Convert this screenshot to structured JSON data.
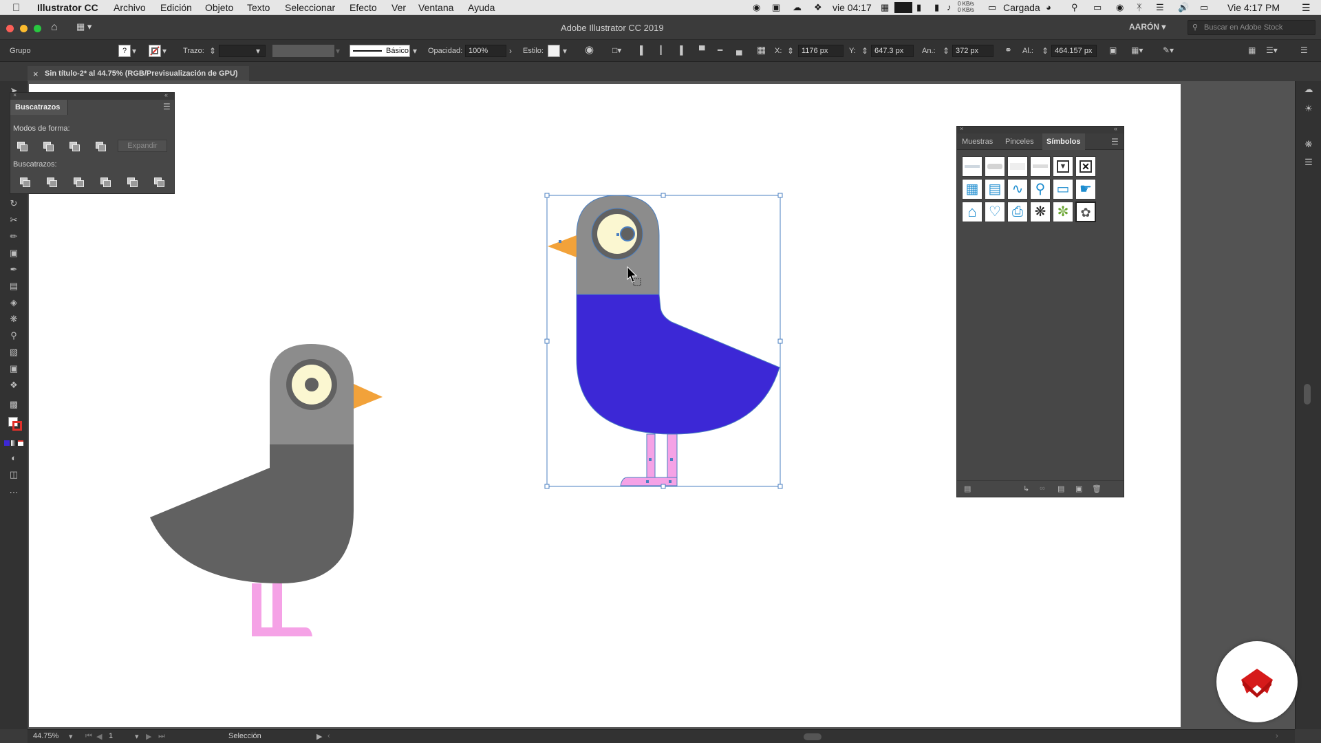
{
  "menubar": {
    "app": "Illustrator CC",
    "items": [
      "Archivo",
      "Edición",
      "Objeto",
      "Texto",
      "Seleccionar",
      "Efecto",
      "Ver",
      "Ventana",
      "Ayuda"
    ],
    "status_time_left": "vie 04:17",
    "net_up": "0 KB/s",
    "net_down": "0 KB/s",
    "battery": "Cargada",
    "clock": "Vie 4:17 PM"
  },
  "titlebar": {
    "title": "Adobe Illustrator CC 2019",
    "user": "AARÓN",
    "search_placeholder": "Buscar en Adobe Stock"
  },
  "control": {
    "selection_type": "Grupo",
    "stroke_label": "Trazo:",
    "brush_label": "Básico",
    "opacity_label": "Opacidad:",
    "opacity_value": "100%",
    "style_label": "Estilo:",
    "x_label": "X:",
    "x_value": "1176 px",
    "y_label": "Y:",
    "y_value": "647.3 px",
    "w_label": "An.:",
    "w_value": "372 px",
    "h_label": "Al.:",
    "h_value": "464.157 px",
    "fill_question": "?"
  },
  "document_tab": {
    "close": "×",
    "title": "Sin título-2* al 44.75% (RGB/Previsualización de GPU)"
  },
  "pathfinder": {
    "title": "Buscatrazos",
    "shape_modes_label": "Modos de forma:",
    "expand_button": "Expandir",
    "pathfinders_label": "Buscatrazos:"
  },
  "symbols_panel": {
    "tabs": [
      "Muestras",
      "Pinceles",
      "Símbolos"
    ],
    "active_tab": "Símbolos"
  },
  "status": {
    "zoom": "44.75%",
    "page": "1",
    "tool": "Selección"
  },
  "colors": {
    "pigeon_gray_head": "#8c8c8c",
    "pigeon_gray_body": "#616161",
    "pigeon_blue_body": "#3c28d6",
    "beak": "#f2a23a",
    "legs": "#f5a2e6",
    "eye_white": "#fbf7d1",
    "selection": "#4a7fc1",
    "logo_red": "#d61a1a"
  }
}
